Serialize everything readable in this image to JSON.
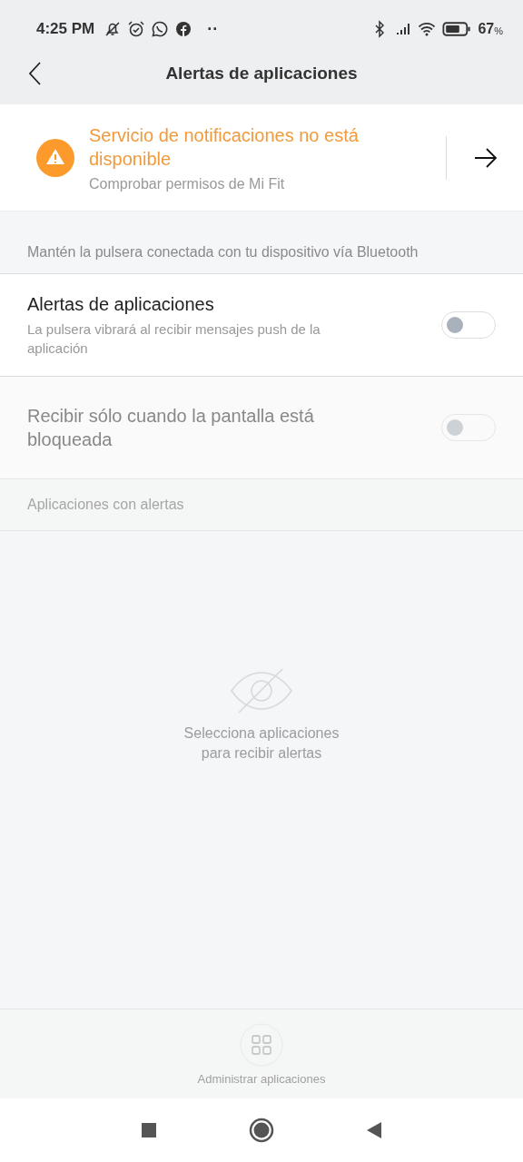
{
  "status_bar": {
    "time": "4:25 PM",
    "more": "··",
    "battery": "67",
    "battery_unit": "%"
  },
  "header": {
    "title": "Alertas de aplicaciones"
  },
  "banner": {
    "title": "Servicio de notificaciones no está disponible",
    "subtitle": "Comprobar permisos de Mi Fit"
  },
  "hint": "Mantén la pulsera conectada con tu dispositivo vía Bluetooth",
  "settings": [
    {
      "title": "Alertas de aplicaciones",
      "subtitle": "La pulsera vibrará al recibir mensajes push de la aplicación",
      "on": false,
      "disabled": false
    },
    {
      "title": "Recibir sólo cuando la pantalla está bloqueada",
      "on": false,
      "disabled": true
    }
  ],
  "apps_section": {
    "title": "Aplicaciones con alertas",
    "empty_text": "Selecciona aplicaciones\npara recibir alertas"
  },
  "manage_button": {
    "label": "Administrar aplicaciones",
    "disabled": true
  }
}
